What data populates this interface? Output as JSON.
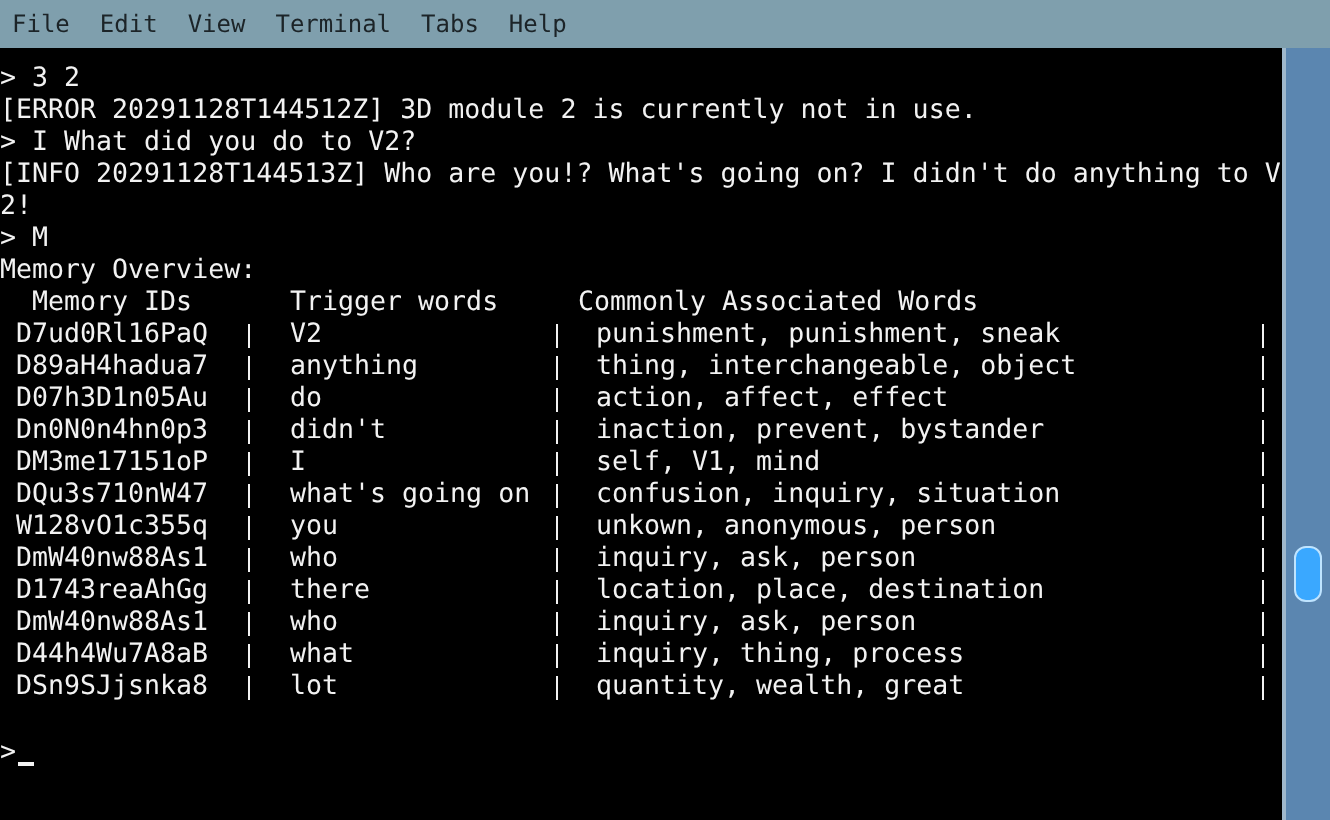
{
  "menu": [
    "File",
    "Edit",
    "View",
    "Terminal",
    "Tabs",
    "Help"
  ],
  "terminal": {
    "lines": [
      "> 3 2",
      "[ERROR 20291128T144512Z] 3D module 2 is currently not in use.",
      "> I What did you do to V2?",
      "[INFO 20291128T144513Z] Who are you!? What's going on? I didn't do anything to V2!",
      "> M",
      "Memory Overview:"
    ],
    "table": {
      "columns": [
        "Memory IDs",
        "Trigger words",
        "Commonly Associated Words"
      ],
      "rows": [
        {
          "id": "D7ud0Rl16PaQ",
          "trigger": "V2",
          "words": "punishment, punishment, sneak"
        },
        {
          "id": "D89aH4hadua7",
          "trigger": "anything",
          "words": "thing, interchangeable, object"
        },
        {
          "id": "D07h3D1n05Au",
          "trigger": "do",
          "words": "action, affect, effect"
        },
        {
          "id": "Dn0N0n4hn0p3",
          "trigger": "didn't",
          "words": "inaction, prevent, bystander"
        },
        {
          "id": "DM3me17151oP",
          "trigger": "I",
          "words": "self, V1, mind"
        },
        {
          "id": "DQu3s710nW47",
          "trigger": "what's going on",
          "words": "confusion, inquiry, situation"
        },
        {
          "id": "W128vO1c355q",
          "trigger": "you",
          "words": "unkown, anonymous, person"
        },
        {
          "id": "DmW40nw88As1",
          "trigger": "who",
          "words": "inquiry, ask, person"
        },
        {
          "id": "D1743reaAhGg",
          "trigger": "there",
          "words": "location, place, destination"
        },
        {
          "id": "DmW40nw88As1",
          "trigger": "who",
          "words": "inquiry, ask, person"
        },
        {
          "id": "D44h4Wu7A8aB",
          "trigger": "what",
          "words": "inquiry, thing, process"
        },
        {
          "id": "DSn9SJjsnka8",
          "trigger": "lot",
          "words": "quantity, wealth, great"
        }
      ]
    },
    "prompt": ">"
  }
}
